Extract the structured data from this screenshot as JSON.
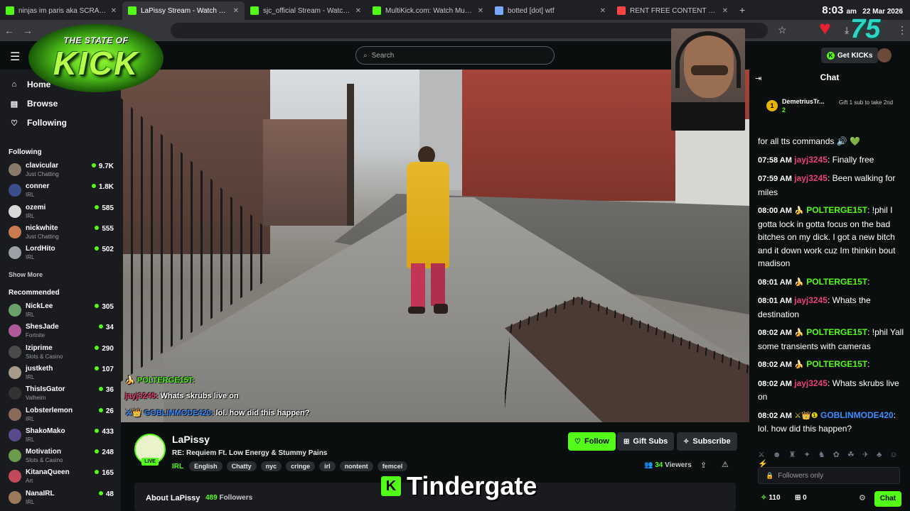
{
  "browser": {
    "tabs": [
      {
        "title": "ninjas im paris aka SCRABSNYC",
        "icon_color": "#53fc18",
        "active": false
      },
      {
        "title": "LaPissy Stream - Watch Live",
        "icon_color": "#53fc18",
        "active": true
      },
      {
        "title": "sjc_official Stream - Watch Live",
        "icon_color": "#53fc18",
        "active": false
      },
      {
        "title": "MultiKick.com: Watch Multiple",
        "icon_color": "#53fc18",
        "active": false
      },
      {
        "title": "botted [dot] wtf",
        "icon_color": "#7aa7ff",
        "active": false
      },
      {
        "title": "RENT FREE CONTENT NETWORK",
        "icon_color": "#ff4444",
        "active": false
      }
    ],
    "new_tab": "+",
    "close": "✕"
  },
  "clock": {
    "time": "8:03",
    "ampm": "am",
    "date": "22 Mar 2026"
  },
  "overlay": {
    "counter": "75",
    "logo_top": "THE STATE OF",
    "logo_main": "KICK",
    "caption": "Tindergate",
    "caption_logo": "K"
  },
  "header": {
    "search_placeholder": "Search",
    "get_kicks": "Get KICKs"
  },
  "sidebar": {
    "nav": [
      {
        "label": "Home",
        "icon": "home-icon"
      },
      {
        "label": "Browse",
        "icon": "browse-icon"
      },
      {
        "label": "Following",
        "icon": "heart-icon"
      }
    ],
    "following_title": "Following",
    "following": [
      {
        "name": "clavicular",
        "category": "Just Chatting",
        "viewers": "9.7K",
        "color": "#8a7a6a"
      },
      {
        "name": "conner",
        "category": "IRL",
        "viewers": "1.8K",
        "color": "#3a4f8a"
      },
      {
        "name": "ozemi",
        "category": "IRL",
        "viewers": "585",
        "color": "#d8d8d8"
      },
      {
        "name": "nickwhite",
        "category": "Just Chatting",
        "viewers": "555",
        "color": "#c77b4f"
      },
      {
        "name": "LordHito",
        "category": "IRL",
        "viewers": "502",
        "color": "#9aa0a6"
      }
    ],
    "show_more": "Show More",
    "recommended_title": "Recommended",
    "recommended": [
      {
        "name": "NickLee",
        "category": "IRL",
        "viewers": "305",
        "color": "#6aa06a"
      },
      {
        "name": "ShesJade",
        "category": "Fortnite",
        "viewers": "34",
        "color": "#b05a9a"
      },
      {
        "name": "Iziprime",
        "category": "Slots & Casino",
        "viewers": "290",
        "color": "#4a4a4a"
      },
      {
        "name": "justketh",
        "category": "IRL",
        "viewers": "107",
        "color": "#a89a8a"
      },
      {
        "name": "ThisIsGator",
        "category": "Valheim",
        "viewers": "36",
        "color": "#333333"
      },
      {
        "name": "Lobsterlemon",
        "category": "IRL",
        "viewers": "26",
        "color": "#8a6a5a"
      },
      {
        "name": "ShakoMako",
        "category": "IRL",
        "viewers": "433",
        "color": "#5a4a8a"
      },
      {
        "name": "Motivation",
        "category": "Slots & Casino",
        "viewers": "248",
        "color": "#6a9a4a"
      },
      {
        "name": "KitanaQueen",
        "category": "Art",
        "viewers": "165",
        "color": "#c04a5a"
      },
      {
        "name": "NanaIRL",
        "category": "IRL",
        "viewers": "48",
        "color": "#9a7a5a"
      }
    ]
  },
  "video_overlay_chat": [
    {
      "user": "POLTERGE15T:",
      "text": "",
      "color": "#53fc18"
    },
    {
      "user": "jayj3245:",
      "text": " Whats skrubs live on",
      "color": "#e84277"
    },
    {
      "user": "GOBLINMODE420:",
      "text": " lol. how did this happen?",
      "color": "#3c8dff"
    }
  ],
  "stream": {
    "streamer": "LaPissy",
    "live_label": "LIVE",
    "title": "RE: Requiem Ft. Low Energy & Stummy Pains",
    "category": "IRL",
    "tags": [
      "English",
      "Chatty",
      "nyc",
      "cringe",
      "irl",
      "nontent",
      "femcel"
    ],
    "follow": "Follow",
    "gift_subs": "Gift Subs",
    "subscribe": "Subscribe",
    "viewers_count": "34",
    "viewers_label": "Viewers",
    "about": "About LaPissy",
    "followers_count": "489",
    "followers_label": "Followers"
  },
  "chat": {
    "title": "Chat",
    "pinned": {
      "rank": "1",
      "name": "DemetriusTr...",
      "count": "2",
      "gift_text": "Gift 1 sub to take 2nd"
    },
    "messages": [
      {
        "time": "",
        "user": "",
        "user_class": "",
        "badge": "",
        "text": "for all tts commands 🔊 💚"
      },
      {
        "time": "07:58 AM",
        "user": "jayj3245",
        "user_class": "u1",
        "badge": "",
        "text": ": Finally free"
      },
      {
        "time": "07:59 AM",
        "user": "jayj3245",
        "user_class": "u1",
        "badge": "",
        "text": ": Been walking for miles"
      },
      {
        "time": "08:00 AM",
        "user": "POLTERGE15T",
        "user_class": "u2",
        "badge": "🍌",
        "text": ": !phil I gotta lock in gotta focus on the bad bitches on my dick. I got a new bitch and it down work cuz Im thinkin bout madison"
      },
      {
        "time": "08:01 AM",
        "user": "POLTERGE15T",
        "user_class": "u2",
        "badge": "🍌",
        "text": ":"
      },
      {
        "time": "08:01 AM",
        "user": "jayj3245",
        "user_class": "u1",
        "badge": "",
        "text": ": Whats the destination"
      },
      {
        "time": "08:02 AM",
        "user": "POLTERGE15T",
        "user_class": "u2",
        "badge": "🍌",
        "text": ": !phil Yall some transients with cameras"
      },
      {
        "time": "08:02 AM",
        "user": "POLTERGE15T",
        "user_class": "u2",
        "badge": "🍌",
        "text": ":"
      },
      {
        "time": "08:02 AM",
        "user": "jayj3245",
        "user_class": "u1",
        "badge": "",
        "text": ": Whats skrubs live on"
      },
      {
        "time": "08:02 AM",
        "user": "GOBLINMODE420",
        "user_class": "u3",
        "badge": "⚔👑❶",
        "text": ": lol. how did this happen?"
      }
    ],
    "followers_only": "Followers only",
    "kicks": "110",
    "gifts": "0",
    "chat_button": "Chat"
  }
}
